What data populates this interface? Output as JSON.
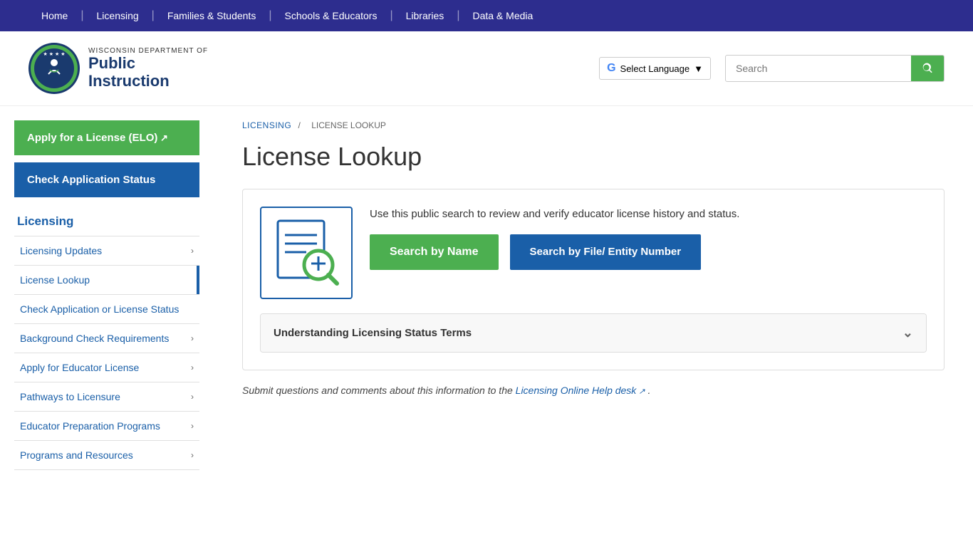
{
  "topnav": {
    "items": [
      {
        "label": "Home",
        "id": "home"
      },
      {
        "label": "Licensing",
        "id": "licensing"
      },
      {
        "label": "Families & Students",
        "id": "families"
      },
      {
        "label": "Schools & Educators",
        "id": "schools"
      },
      {
        "label": "Libraries",
        "id": "libraries"
      },
      {
        "label": "Data & Media",
        "id": "data"
      }
    ]
  },
  "header": {
    "logo": {
      "dept_small": "WISCONSIN DEPARTMENT OF",
      "dept_large_line1": "Public",
      "dept_large_line2": "Instruction"
    },
    "translate_label": "Select Language",
    "search_placeholder": "Search"
  },
  "sidebar": {
    "btn_elo": "Apply for a License (ELO)",
    "btn_check": "Check Application Status",
    "section_title": "Licensing",
    "menu_items": [
      {
        "label": "Licensing Updates",
        "has_chevron": true,
        "active": false,
        "id": "licensing-updates"
      },
      {
        "label": "License Lookup",
        "has_chevron": false,
        "active": true,
        "id": "license-lookup"
      },
      {
        "label": "Check Application or License Status",
        "has_chevron": false,
        "active": false,
        "id": "check-app-status"
      },
      {
        "label": "Background Check Requirements",
        "has_chevron": true,
        "active": false,
        "id": "background-check"
      },
      {
        "label": "Apply for Educator License",
        "has_chevron": true,
        "active": false,
        "id": "apply-educator"
      },
      {
        "label": "Pathways to Licensure",
        "has_chevron": true,
        "active": false,
        "id": "pathways"
      },
      {
        "label": "Educator Preparation Programs",
        "has_chevron": true,
        "active": false,
        "id": "educator-prep"
      },
      {
        "label": "Programs and Resources",
        "has_chevron": true,
        "active": false,
        "id": "programs-resources"
      }
    ]
  },
  "main": {
    "breadcrumb": {
      "parent": "LICENSING",
      "current": "LICENSE LOOKUP"
    },
    "page_title": "License Lookup",
    "lookup_desc": "Use this public search to review and verify educator license history and status.",
    "btn_search_name": "Search by Name",
    "btn_search_file": "Search by File/ Entity Number",
    "accordion_label": "Understanding Licensing Status Terms",
    "submit_note_pre": "Submit questions and comments about this information to the ",
    "submit_note_link": "Licensing Online Help desk",
    "submit_note_post": "."
  }
}
